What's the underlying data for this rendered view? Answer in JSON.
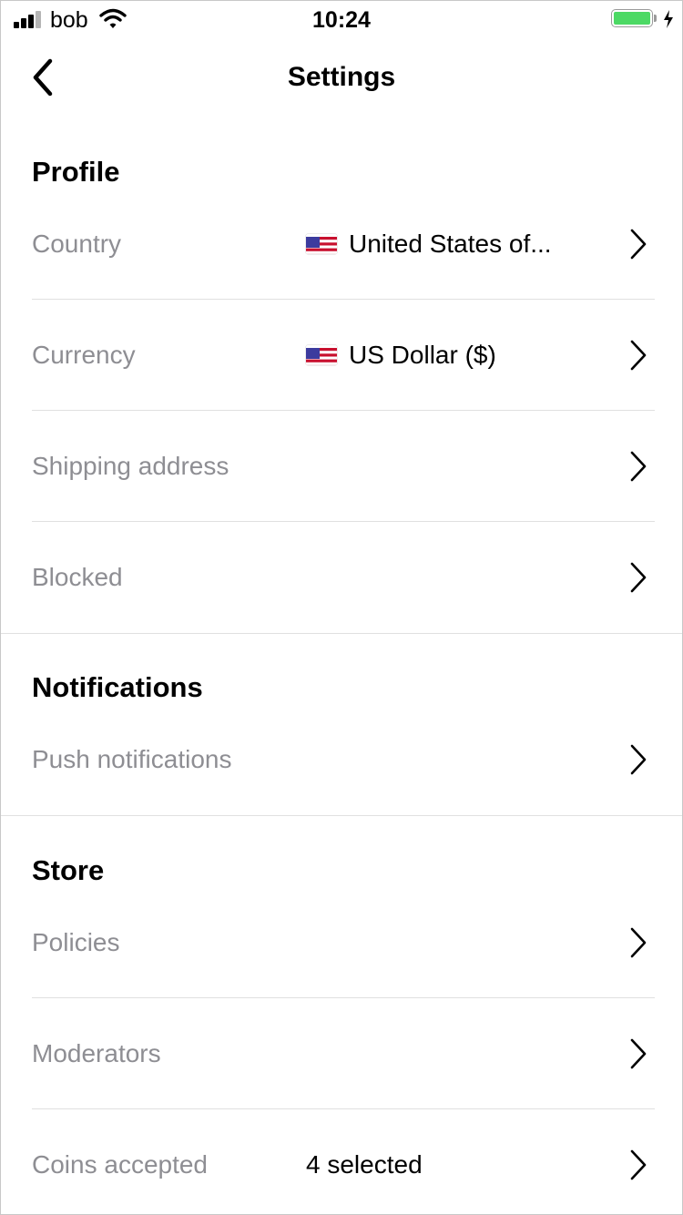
{
  "status_bar": {
    "carrier": "bob",
    "time": "10:24",
    "battery_color": "#4cd964"
  },
  "nav": {
    "title": "Settings",
    "back_icon": "chevron-left-icon"
  },
  "sections": [
    {
      "title": "Profile",
      "rows": [
        {
          "label": "Country",
          "value": "United States of...",
          "flag": "us-flag-icon"
        },
        {
          "label": "Currency",
          "value": "US Dollar ($)",
          "flag": "us-flag-icon"
        },
        {
          "label": "Shipping address",
          "value": ""
        },
        {
          "label": "Blocked",
          "value": ""
        }
      ]
    },
    {
      "title": "Notifications",
      "rows": [
        {
          "label": "Push notifications",
          "value": ""
        }
      ]
    },
    {
      "title": "Store",
      "rows": [
        {
          "label": "Policies",
          "value": ""
        },
        {
          "label": "Moderators",
          "value": ""
        },
        {
          "label": "Coins accepted",
          "value": "4 selected"
        }
      ]
    }
  ],
  "colors": {
    "label_gray": "#8e8e93",
    "divider": "#e0e0e0"
  }
}
